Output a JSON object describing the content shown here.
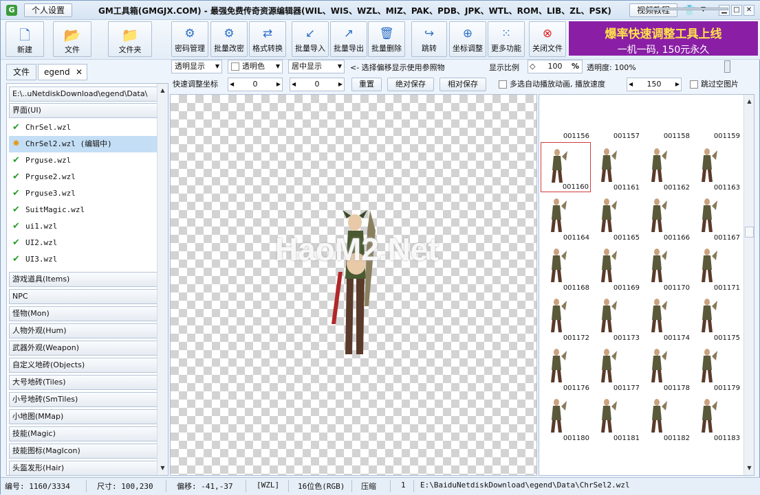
{
  "titlebar": {
    "app_icon": "G",
    "personal_settings": "个人设置",
    "title": "GM工具箱(GMGJX.COM) - 最强免费传奇资源编辑器(WIL、WIS、WZL、MIZ、PAK、PDB、JPK、WTL、ROM、LIB、ZL、PSK)",
    "video_tutorial": "视频教程",
    "icons": {
      "shirt": "shirt-icon",
      "dropdown": "chevron-down-icon",
      "minimize": "minimize-icon",
      "maximize": "maximize-icon",
      "close": "close-icon"
    }
  },
  "toolbar": {
    "new": "新建",
    "file": "文件",
    "folder": "文件夹",
    "password": "密码管理",
    "batch_password": "批量改密",
    "convert": "格式转换",
    "batch_import": "批量导入",
    "batch_export": "批量导出",
    "batch_delete": "批量删除",
    "jump": "跳转",
    "coord_adjust": "坐标调整",
    "more": "更多功能",
    "close_file": "关闭文件",
    "ad_line1": "爆率快速调整工具上线",
    "ad_line2": "一机一码, 150元永久"
  },
  "tabs": {
    "tab1": "文件",
    "tab2": "egend"
  },
  "left": {
    "path": "E:\\..uNetdiskDownload\\egend\\Data\\",
    "category_ui": "界面(UI)",
    "files": [
      {
        "name": "ChrSel.wzl",
        "state": "ok"
      },
      {
        "name": "ChrSel2.wzl (编辑中)",
        "state": "editing"
      },
      {
        "name": "Prguse.wzl",
        "state": "ok"
      },
      {
        "name": "Prguse2.wzl",
        "state": "ok"
      },
      {
        "name": "Prguse3.wzl",
        "state": "ok"
      },
      {
        "name": "SuitMagic.wzl",
        "state": "ok"
      },
      {
        "name": "ui1.wzl",
        "state": "ok"
      },
      {
        "name": "UI2.wzl",
        "state": "ok"
      },
      {
        "name": "UI3.wzl",
        "state": "ok"
      }
    ],
    "categories": [
      "游戏道具(Items)",
      "NPC",
      "怪物(Mon)",
      "人物外观(Hum)",
      "武器外观(Weapon)",
      "自定义地砖(Objects)",
      "大号地砖(Tiles)",
      "小号地砖(SmTiles)",
      "小地图(MMap)",
      "技能(Magic)",
      "技能图标(MagIcon)",
      "头盔发形(Hair)"
    ]
  },
  "options": {
    "display_mode": "透明显示",
    "transparent_color": "透明色",
    "align": "居中显示",
    "hint": "<- 选择偏移显示使用参照物",
    "scale_label": "显示比例",
    "scale_value": "100",
    "scale_unit": "%",
    "opacity": "透明度: 100%",
    "quick_coord": "快速调整坐标",
    "x_value": "0",
    "y_value": "0",
    "reset": "重置",
    "abs_save": "绝对保存",
    "rel_save": "相对保存",
    "autoplay": "多选自动播放动画, 播放速度",
    "speed": "150",
    "skip_empty": "跳过空图片"
  },
  "canvas": {
    "watermark": "HaoM2.Net"
  },
  "thumbs": [
    "001156",
    "001157",
    "001158",
    "001159",
    "001160",
    "001161",
    "001162",
    "001163",
    "001164",
    "001165",
    "001166",
    "001167",
    "001168",
    "001169",
    "001170",
    "001171",
    "001172",
    "001173",
    "001174",
    "001175",
    "001176",
    "001177",
    "001178",
    "001179",
    "001180",
    "001181",
    "001182",
    "001183"
  ],
  "status": {
    "index": "编号: 1160/3334",
    "size": "尺寸: 100,230",
    "offset": "偏移: -41,-37",
    "format": "[WZL]",
    "color": "16位色(RGB)",
    "compress": "压缩",
    "compress_val": "1",
    "path": "E:\\BaiduNetdiskDownload\\egend\\Data\\ChrSel2.wzl"
  }
}
